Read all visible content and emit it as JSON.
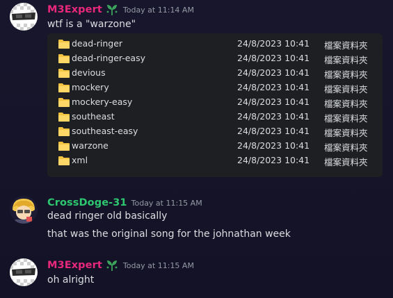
{
  "messages": [
    {
      "username": "M3Expert",
      "username_color": "#e8287a",
      "timestamp": "Today at 11:14 AM",
      "lines": [
        "wtf is a \"warzone\""
      ],
      "file_listing": [
        {
          "name": "dead-ringer",
          "date": "24/8/2023 10:41",
          "type": "檔案資料夾"
        },
        {
          "name": "dead-ringer-easy",
          "date": "24/8/2023 10:41",
          "type": "檔案資料夾"
        },
        {
          "name": "devious",
          "date": "24/8/2023 10:41",
          "type": "檔案資料夾"
        },
        {
          "name": "mockery",
          "date": "24/8/2023 10:41",
          "type": "檔案資料夾"
        },
        {
          "name": "mockery-easy",
          "date": "24/8/2023 10:41",
          "type": "檔案資料夾"
        },
        {
          "name": "southeast",
          "date": "24/8/2023 10:41",
          "type": "檔案資料夾"
        },
        {
          "name": "southeast-easy",
          "date": "24/8/2023 10:41",
          "type": "檔案資料夾"
        },
        {
          "name": "warzone",
          "date": "24/8/2023 10:41",
          "type": "檔案資料夾"
        },
        {
          "name": "xml",
          "date": "24/8/2023 10:41",
          "type": "檔案資料夾"
        }
      ]
    },
    {
      "username": "CrossDoge-31",
      "username_color": "#2dc770",
      "timestamp": "Today at 11:15 AM",
      "lines": [
        "dead ringer old basically",
        "that was the original song for the johnathan week"
      ]
    },
    {
      "username": "M3Expert",
      "username_color": "#e8287a",
      "timestamp": "Today at 11:15 AM",
      "lines": [
        "oh alright"
      ]
    }
  ],
  "colors": {
    "background": "#16142a",
    "code_block_bg": "#1e1f22",
    "timestamp": "#949ba4",
    "text": "#dbdee1",
    "folder": "#f5c342",
    "badge": "#3ba55c"
  },
  "icons": {
    "avatar_m3expert": "sunglasses-checker-avatar",
    "avatar_crossdoge": "yellow-haired-character-avatar",
    "badge": "leaf-badge-icon",
    "folder": "folder-icon"
  }
}
